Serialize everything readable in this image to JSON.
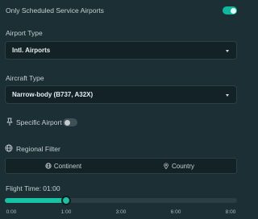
{
  "scheduled_filter": {
    "label": "Only Scheduled Service Airports",
    "enabled": true
  },
  "airport_type": {
    "label": "Airport Type",
    "value": "Intl. Airports"
  },
  "aircraft_type": {
    "label": "Aircraft Type",
    "value": "Narrow-body (B737, A32X)"
  },
  "specific_airport": {
    "label": "Specific Airport",
    "enabled": false,
    "icon": "pin-icon"
  },
  "regional_filter": {
    "label": "Regional Filter",
    "icon": "globe-icon",
    "options": [
      {
        "label": "Continent",
        "icon": "globe-icon"
      },
      {
        "label": "Country",
        "icon": "location-pin-icon"
      }
    ]
  },
  "flight_time": {
    "label": "Flight Time: 01:00",
    "value_hours": 1,
    "max_hours": 8,
    "ticks": [
      "0:00",
      "1:00",
      "3:00",
      "6:00",
      "8:00"
    ]
  },
  "colors": {
    "accent": "#16c3a5",
    "background": "#1b2f35",
    "field": "#132227"
  }
}
